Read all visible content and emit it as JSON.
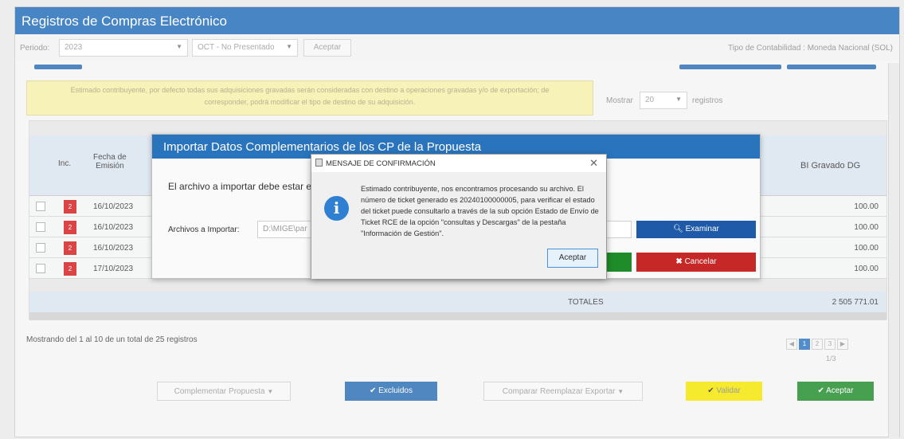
{
  "window_title": "Registros de Compras Electrónico",
  "toolbar": {
    "periodo_label": "Periodo:",
    "periodo_value": "2023",
    "mes_value": "OCT - No Presentado",
    "aceptar_label": "Aceptar",
    "tipo_contabilidad": "Tipo de Contabilidad : Moneda Nacional (SOL)"
  },
  "notice": {
    "line1": "Estimado contribuyente, por defecto todas sus adquisiciones gravadas serán consideradas con destino a operaciones gravadas y/o de exportación; de",
    "line2": "corresponder, podrá modificar el tipo de destino de su adquisición."
  },
  "mostrar": {
    "label": "Mostrar",
    "value": "20",
    "suffix": "registros"
  },
  "table": {
    "headers": {
      "inc": "Inc.",
      "fecha1": "Fecha de",
      "fecha2": "Emisión",
      "bi": "BI Gravado DG"
    },
    "rows": [
      {
        "inc": "2",
        "fecha": "16/10/2023",
        "bi": "100.00"
      },
      {
        "inc": "2",
        "fecha": "16/10/2023",
        "bi": "100.00"
      },
      {
        "inc": "2",
        "fecha": "16/10/2023",
        "bi": "100.00"
      },
      {
        "inc": "2",
        "fecha": "17/10/2023",
        "bi": "100.00"
      }
    ],
    "totales_label": "TOTALES",
    "totales_value": "2 505 771.01"
  },
  "footer": {
    "showing": "Mostrando del 1 al 10 de un total de 25 registros",
    "pages": [
      "1",
      "2",
      "3"
    ],
    "page_info": "1/3"
  },
  "bottom_buttons": {
    "complementar": "Complementar Propuesta",
    "excluidos": "Excluidos",
    "comparar": "Comparar Reemplazar Exportar",
    "validar": "Validar",
    "aceptar": "Aceptar"
  },
  "import_dialog": {
    "title": "Importar Datos Complementarios de los CP de la Propuesta",
    "text": "El archivo a importar debe estar e",
    "archivos_label": "Archivos a Importar:",
    "path": "D:\\MIGE\\par",
    "examinar": "Examinar",
    "cancelar": "Cancelar"
  },
  "message_box": {
    "title": "MENSAJE DE CONFIRMACIÓN",
    "body": "Estimado contribuyente, nos encontramos procesando su archivo. El número de ticket generado es 20240100000005, para verificar el estado del ticket puede consultarlo a través de la sub opción Estado de Envío de Ticket RCE de la opción \"consultas y Descargas\" de la pestaña \"Información de Gestión\".",
    "ok": "Aceptar"
  },
  "colors": {
    "primary": "#1f6bb8",
    "danger": "#c62828",
    "success": "#1f8c2a",
    "warning": "#f3e600"
  }
}
